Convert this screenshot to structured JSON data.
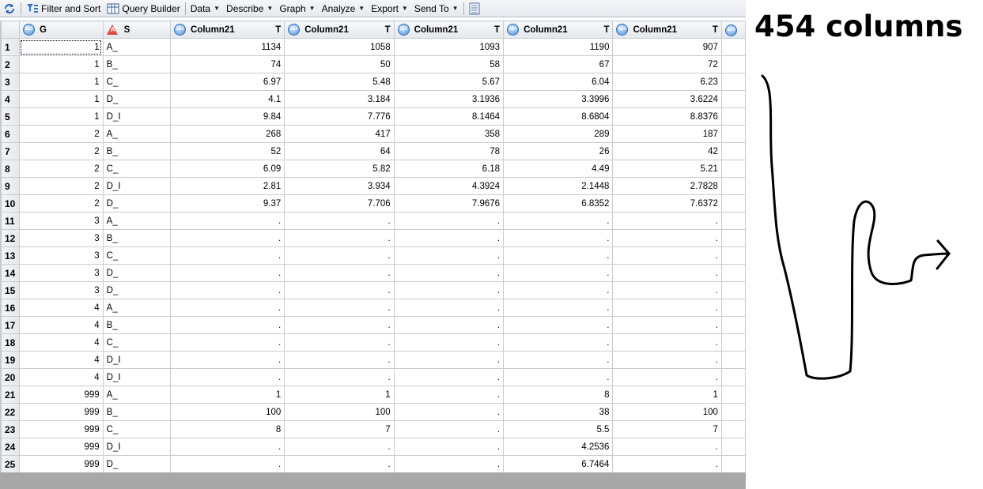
{
  "toolbar": {
    "items": [
      {
        "label": "Filter and Sort",
        "icon": "filter-sort-icon"
      },
      {
        "label": "Query Builder",
        "icon": "query-builder-icon"
      },
      {
        "label": "Data",
        "menu": true
      },
      {
        "label": "Describe",
        "menu": true
      },
      {
        "label": "Graph",
        "menu": true
      },
      {
        "label": "Analyze",
        "menu": true
      },
      {
        "label": "Export",
        "menu": true
      },
      {
        "label": "Send To",
        "menu": true
      }
    ]
  },
  "grid": {
    "columns": [
      {
        "label": "G",
        "type": "num",
        "suffix": ""
      },
      {
        "label": "S",
        "type": "char",
        "suffix": ""
      },
      {
        "label": "Column21",
        "type": "num",
        "suffix": "T"
      },
      {
        "label": "Column21",
        "type": "num",
        "suffix": "T"
      },
      {
        "label": "Column21",
        "type": "num",
        "suffix": "T"
      },
      {
        "label": "Column21",
        "type": "num",
        "suffix": "T"
      },
      {
        "label": "Column21",
        "type": "num",
        "suffix": "T"
      }
    ],
    "rows": [
      [
        "1",
        "1",
        "A_",
        "1134",
        "1058",
        "1093",
        "1190",
        "907"
      ],
      [
        "2",
        "1",
        "B_",
        "74",
        "50",
        "58",
        "67",
        "72"
      ],
      [
        "3",
        "1",
        "C_",
        "6.97",
        "5.48",
        "5.67",
        "6.04",
        "6.23"
      ],
      [
        "4",
        "1",
        "D_",
        "4.1",
        "3.184",
        "3.1936",
        "3.3996",
        "3.6224"
      ],
      [
        "5",
        "1",
        "D_I",
        "9.84",
        "7.776",
        "8.1464",
        "8.6804",
        "8.8376"
      ],
      [
        "6",
        "2",
        "A_",
        "268",
        "417",
        "358",
        "289",
        "187"
      ],
      [
        "7",
        "2",
        "B_",
        "52",
        "64",
        "78",
        "26",
        "42"
      ],
      [
        "8",
        "2",
        "C_",
        "6.09",
        "5.82",
        "6.18",
        "4.49",
        "5.21"
      ],
      [
        "9",
        "2",
        "D_I",
        "2.81",
        "3.934",
        "4.3924",
        "2.1448",
        "2.7828"
      ],
      [
        "10",
        "2",
        "D_",
        "9.37",
        "7.706",
        "7.9676",
        "6.8352",
        "7.6372"
      ],
      [
        "11",
        "3",
        "A_",
        ".",
        ".",
        ".",
        ".",
        "."
      ],
      [
        "12",
        "3",
        "B_",
        ".",
        ".",
        ".",
        ".",
        "."
      ],
      [
        "13",
        "3",
        "C_",
        ".",
        ".",
        ".",
        ".",
        "."
      ],
      [
        "14",
        "3",
        "D_",
        ".",
        ".",
        ".",
        ".",
        "."
      ],
      [
        "15",
        "3",
        "D_",
        ".",
        ".",
        ".",
        ".",
        "."
      ],
      [
        "16",
        "4",
        "A_",
        ".",
        ".",
        ".",
        ".",
        "."
      ],
      [
        "17",
        "4",
        "B_",
        ".",
        ".",
        ".",
        ".",
        "."
      ],
      [
        "18",
        "4",
        "C_",
        ".",
        ".",
        ".",
        ".",
        "."
      ],
      [
        "19",
        "4",
        "D_I",
        ".",
        ".",
        ".",
        ".",
        "."
      ],
      [
        "20",
        "4",
        "D_I",
        ".",
        ".",
        ".",
        ".",
        "."
      ],
      [
        "21",
        "999",
        "A_",
        "1",
        "1",
        ".",
        "8",
        "1"
      ],
      [
        "22",
        "999",
        "B_",
        "100",
        "100",
        ".",
        "38",
        "100"
      ],
      [
        "23",
        "999",
        "C_",
        "8",
        "7",
        ".",
        "5.5",
        "7"
      ],
      [
        "24",
        "999",
        "D_I",
        ".",
        ".",
        ".",
        "4.2536",
        "."
      ],
      [
        "25",
        "999",
        "D_",
        ".",
        ".",
        ".",
        "6.7464",
        "."
      ]
    ]
  },
  "annotation": {
    "text": "454 columns"
  }
}
